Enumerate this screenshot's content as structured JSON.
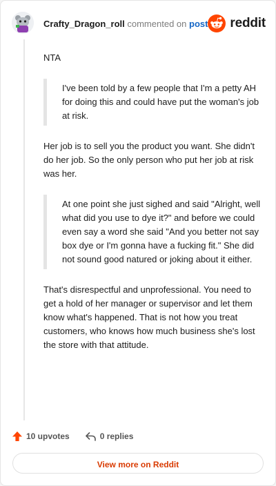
{
  "header": {
    "username": "Crafty_Dragon_roll",
    "action_text": "commented on",
    "post_link": "post",
    "brand_name": "reddit",
    "brand_color": "#ff4500",
    "avatar_icon": "cartoon-creature-avatar"
  },
  "comment": {
    "opening": "NTA",
    "quote_1": "I've been told by a few people that I'm a petty AH for doing this and could have put the woman's job at risk.",
    "reply_1": "Her job is to sell you the product you want. She didn't do her job. So the only person who put her job at risk was her.",
    "quote_2": "At one point she just sighed and said \"Alright, well what did you use to dye it?\" and before we could even say a word she said \"And you better not say box dye or I'm gonna have a fucking fit.\" She did not sound good natured or joking about it either.",
    "reply_2": "That's disrespectful and unprofessional. You need to get a hold of her manager or supervisor and let them know what's happened. That is not how you treat customers, who knows how much business she's lost the store with that attitude."
  },
  "footer": {
    "upvotes": "10 upvotes",
    "upvote_icon": "up-arrow-icon",
    "upvote_color": "#ff4500",
    "replies": "0 replies",
    "reply_icon": "reply-arrow-icon"
  },
  "actions": {
    "view_more": "View more on Reddit"
  }
}
